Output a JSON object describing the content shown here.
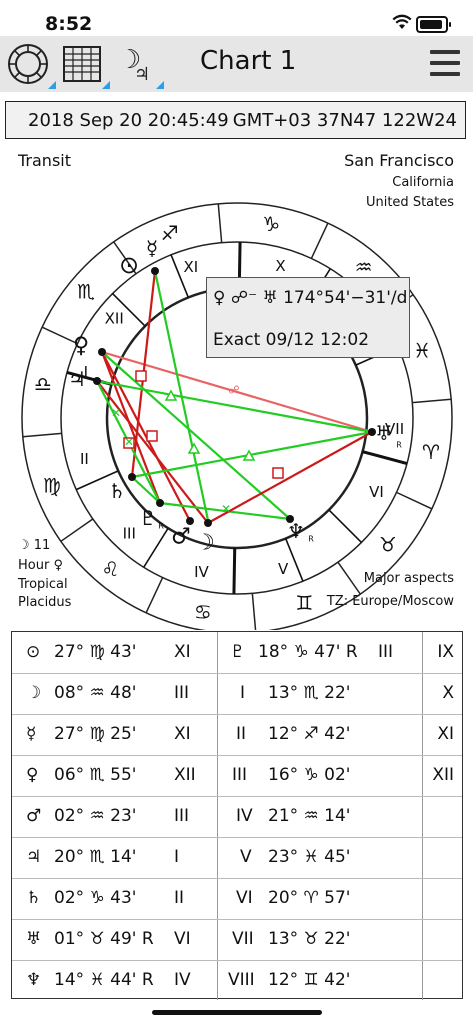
{
  "status": {
    "time": "8:52"
  },
  "toolbar": {
    "title": "Chart 1",
    "buttons": [
      "wheel-view",
      "table-view",
      "transit-view"
    ],
    "accent": "#2a9ee8"
  },
  "header": {
    "datetime": "2018 Sep 20 20:45:49",
    "zone": "GMT+03  37N47 122W24"
  },
  "chart": {
    "mode_label": "Transit",
    "city": "San Francisco",
    "state": "California",
    "country": "United States",
    "moon_info": "☽ 11",
    "hour_info": "Hour ♀",
    "zodiac": "Tropical",
    "houses": "Placidus",
    "aspects_label": "Major aspects",
    "tz_label": "TZ: Europe/Moscow",
    "colors": {
      "hard": "#cc1a1a",
      "soft": "#22cc22",
      "opposition": "#e86464"
    }
  },
  "aspect_info": {
    "line1": "♀ ☍⁻ ♅ 174°54'−31'/d",
    "line2": "Exact 09/12 12:02"
  },
  "table": {
    "planets": [
      {
        "sym": "⊙",
        "pos": "27° ♍ 43'",
        "house": "XI"
      },
      {
        "sym": "☽",
        "pos": "08° ♒ 48'",
        "house": "III"
      },
      {
        "sym": "☿",
        "pos": "27° ♍ 25'",
        "house": "XI"
      },
      {
        "sym": "♀",
        "pos": "06° ♏ 55'",
        "house": "XII"
      },
      {
        "sym": "♂",
        "pos": "02° ♒ 23'",
        "house": "III"
      },
      {
        "sym": "♃",
        "pos": "20° ♏ 14'",
        "house": "I"
      },
      {
        "sym": "♄",
        "pos": "02° ♑ 43'",
        "house": "II"
      },
      {
        "sym": "♅",
        "pos": "01° ♉ 49' R",
        "house": "VI"
      },
      {
        "sym": "♆",
        "pos": "14° ♓ 44' R",
        "house": "IV"
      }
    ],
    "pluto": {
      "sym": "♇",
      "pos": "18° ♑ 47' R",
      "house": "III"
    },
    "cusps": [
      {
        "num": "I",
        "pos": "13° ♏ 22'"
      },
      {
        "num": "II",
        "pos": "12° ♐ 42'"
      },
      {
        "num": "III",
        "pos": "16° ♑ 02'"
      },
      {
        "num": "IV",
        "pos": "21° ♒ 14'"
      },
      {
        "num": "V",
        "pos": "23° ♓ 45'"
      },
      {
        "num": "VI",
        "pos": "20° ♈ 57'"
      },
      {
        "num": "VII",
        "pos": "13° ♉ 22'"
      },
      {
        "num": "VIII",
        "pos": "12° ♊ 42'"
      }
    ],
    "right_col": [
      "IX",
      "X",
      "XI",
      "XII"
    ]
  }
}
